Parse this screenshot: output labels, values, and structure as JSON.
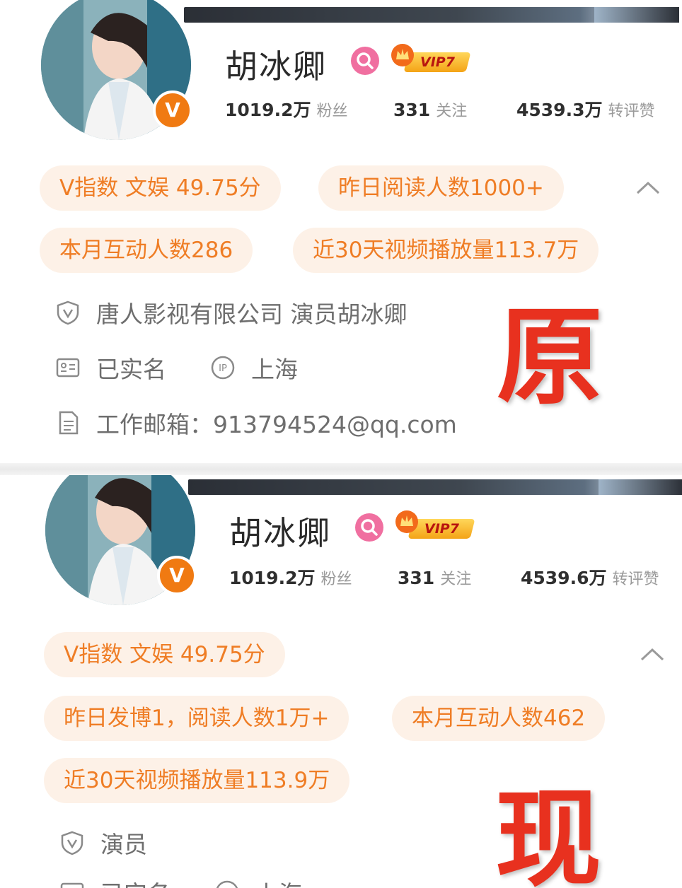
{
  "top": {
    "name": "胡冰卿",
    "vip_label": "VIP7",
    "v_badge": "V",
    "stats": [
      {
        "num": "1019.2万",
        "label": "粉丝"
      },
      {
        "num": "331",
        "label": "关注"
      },
      {
        "num": "4539.3万",
        "label": "转评赞"
      }
    ],
    "chips": [
      "V指数 文娱 49.75分",
      "昨日阅读人数1000+",
      "本月互动人数286",
      "近30天视频播放量113.7万"
    ],
    "info": {
      "verify_text": "唐人影视有限公司 演员胡冰卿",
      "realname_text": "已实名",
      "ip_text": "上海",
      "email_text": "工作邮箱：913794524@qq.com"
    },
    "stamp": "原"
  },
  "bottom": {
    "name": "胡冰卿",
    "vip_label": "VIP7",
    "v_badge": "V",
    "stats": [
      {
        "num": "1019.2万",
        "label": "粉丝"
      },
      {
        "num": "331",
        "label": "关注"
      },
      {
        "num": "4539.6万",
        "label": "转评赞"
      }
    ],
    "chips": [
      "V指数 文娱 49.75分",
      "昨日发博1，阅读人数1万+",
      "本月互动人数462",
      "近30天视频播放量113.9万"
    ],
    "info": {
      "verify_text": "演员",
      "realname_text": "已实名",
      "ip_text": "上海"
    },
    "stamp": "现"
  },
  "colors": {
    "chip_bg": "#fdf1e7",
    "chip_text": "#ef7d25",
    "verified_orange": "#f07a12",
    "stamp_red": "#e8311f",
    "search_badge_pink": "#f06fa0"
  },
  "icons": [
    "chevron-up-icon",
    "shield-v-icon",
    "id-card-icon",
    "ip-icon",
    "document-icon",
    "search-icon",
    "crown-icon"
  ]
}
